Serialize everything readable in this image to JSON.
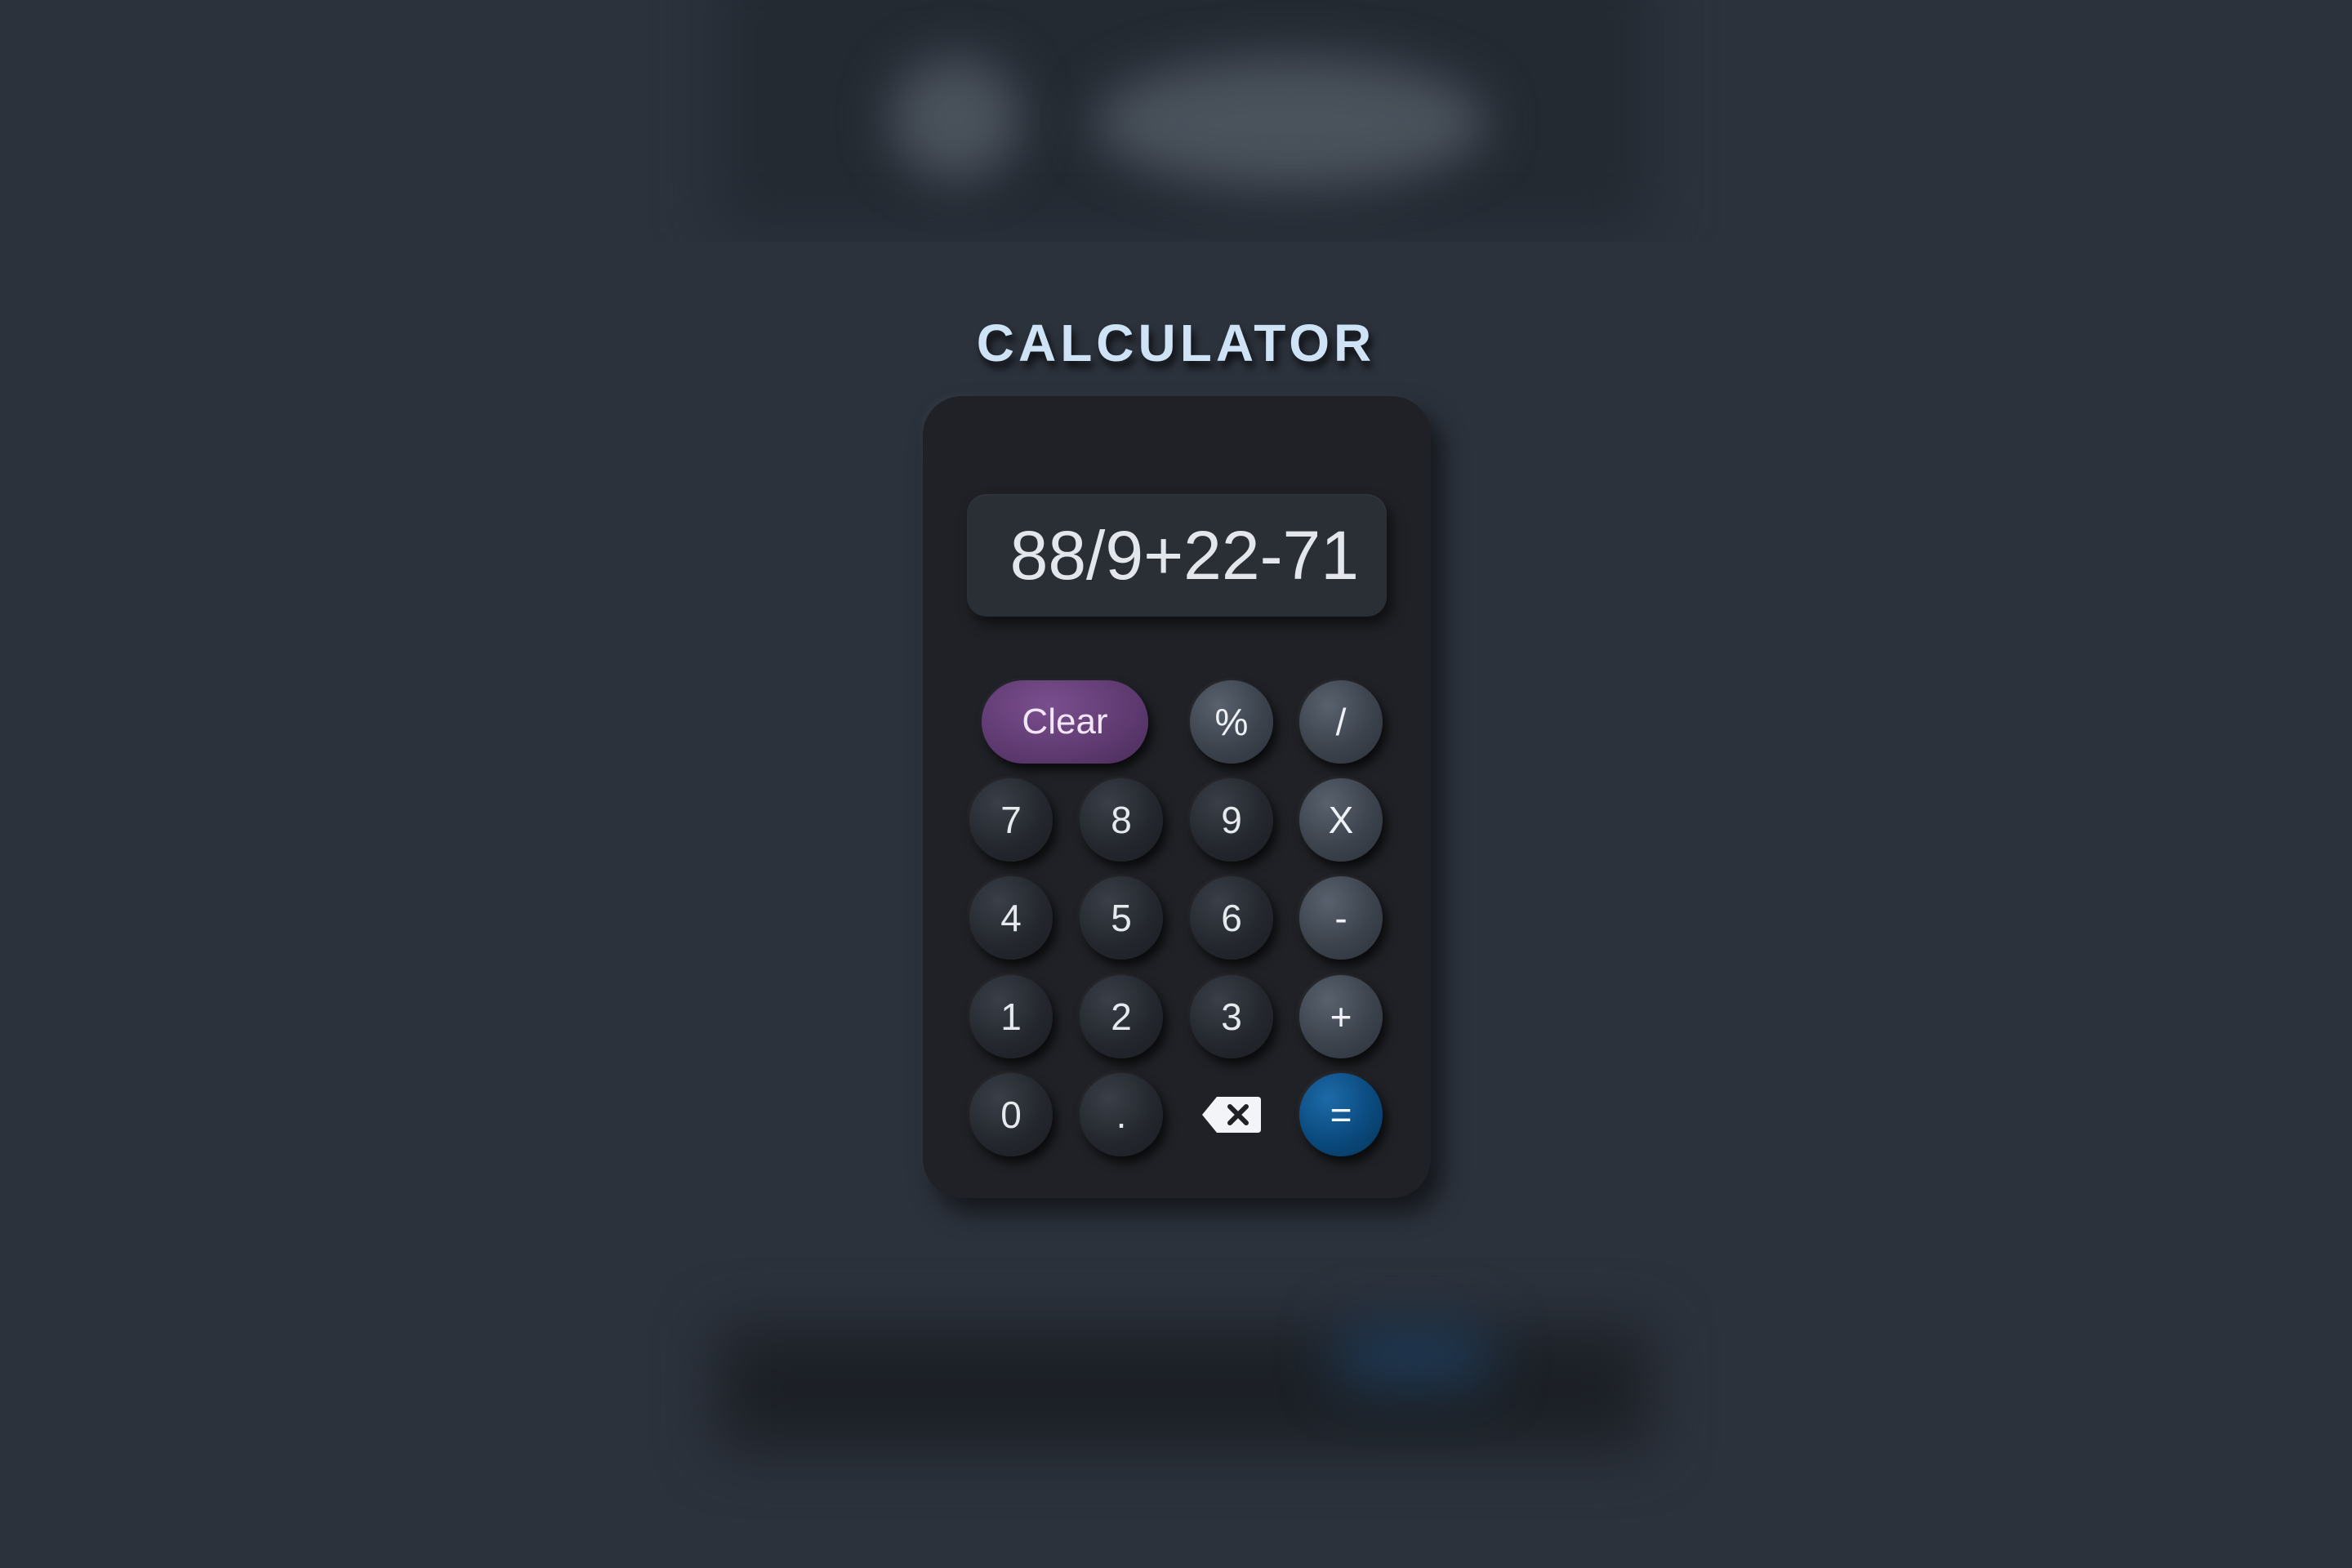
{
  "app": {
    "title": "CALCULATOR"
  },
  "display": {
    "value": "88/9+22-71"
  },
  "keys": {
    "clear": "Clear",
    "percent": "%",
    "divide": "/",
    "seven": "7",
    "eight": "8",
    "nine": "9",
    "multiply": "X",
    "four": "4",
    "five": "5",
    "six": "6",
    "subtract": "-",
    "one": "1",
    "two": "2",
    "three": "3",
    "add": "+",
    "zero": "0",
    "decimal": ".",
    "backspace_icon": "backspace-icon",
    "equals": "="
  },
  "colors": {
    "background": "#2c323c",
    "calculator_body": "#1f2126",
    "title": "#cfe3f6",
    "clear_key": "#5e3a70",
    "equals_key": "#0a4a7e",
    "operator_key": "#3c434d",
    "number_key": "#24282e"
  }
}
